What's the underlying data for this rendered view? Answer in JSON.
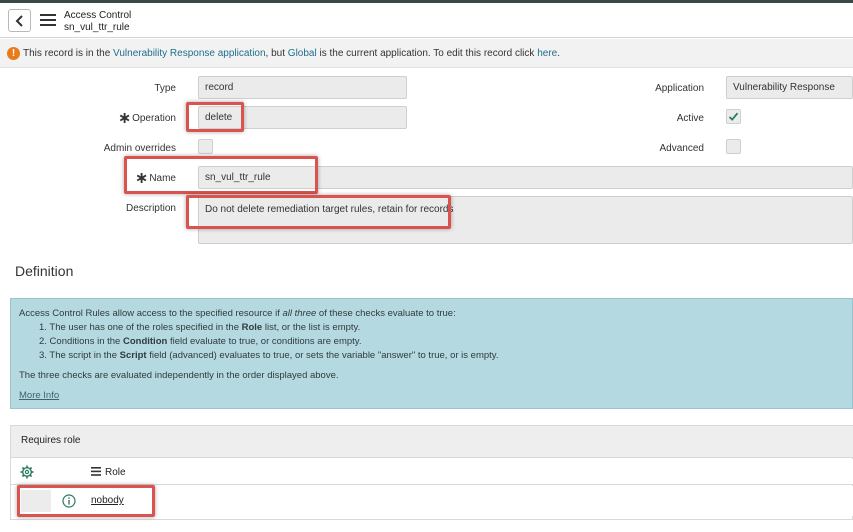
{
  "header": {
    "title": "Access Control",
    "subtitle": "sn_vul_ttr_rule"
  },
  "notice": {
    "part1": "This record is in the ",
    "app_link": "Vulnerability Response application",
    "part2": ", but ",
    "global_link": "Global",
    "part3": " is the current application. To edit this record click ",
    "here_link": "here",
    "part4": "."
  },
  "form": {
    "type_label": "Type",
    "type_value": "record",
    "operation_label": "Operation",
    "operation_value": "delete",
    "admin_overrides_label": "Admin overrides",
    "name_label": "Name",
    "name_value": "sn_vul_ttr_rule",
    "description_label": "Description",
    "description_value": "Do not delete remediation target rules, retain for records",
    "application_label": "Application",
    "application_value": "Vulnerability Response",
    "active_label": "Active",
    "advanced_label": "Advanced",
    "active_checked": true,
    "admin_overrides_checked": false,
    "advanced_checked": false
  },
  "definition": {
    "title": "Definition",
    "intro_a": "Access Control Rules allow access to the specified resource if ",
    "intro_em": "all three",
    "intro_b": " of these checks evaluate to true:",
    "item1_a": "1. The user has one of the roles specified in the ",
    "item1_b": "Role",
    "item1_c": " list, or the list is empty.",
    "item2_a": "2. Conditions in the ",
    "item2_b": "Condition",
    "item2_c": " field evaluate to true, or conditions are empty.",
    "item3_a": "3. The script in the ",
    "item3_b": "Script",
    "item3_c": " field (advanced) evaluates to true, or sets the variable \"answer\" to true, or is empty.",
    "summary": "The three checks are evaluated independently in the order displayed above.",
    "more_info": "More Info"
  },
  "requires_role": {
    "title": "Requires role",
    "column_role": "Role",
    "rows": [
      {
        "role": "nobody"
      }
    ]
  },
  "colors": {
    "info_bg": "#b5d9e0",
    "highlight": "#d9534f",
    "notice_icon": "#e87b1b",
    "link": "#1f6f8b"
  },
  "icons": {
    "back": "chevron-left-icon",
    "menu": "hamburger-icon",
    "notice": "exclamation-circle-icon",
    "settings": "gear-icon",
    "info": "info-circle-icon",
    "check": "checkmark-icon"
  }
}
